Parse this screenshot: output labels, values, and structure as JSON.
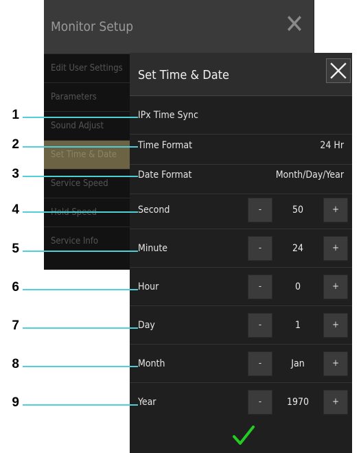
{
  "background_dialog": {
    "title": "Monitor Setup",
    "items": [
      "Edit User Settings",
      "Parameters",
      "Sound Adjust",
      "Set Time & Date",
      "Service Speed",
      "Hold Speed",
      "Service Info"
    ],
    "selected_index": 3
  },
  "dialog": {
    "title": "Set Time & Date",
    "rows": [
      {
        "label": "IPx Time Sync"
      },
      {
        "label": "Time Format",
        "value": "24 Hr"
      },
      {
        "label": "Date Format",
        "value": "Month/Day/Year"
      },
      {
        "label": "Second",
        "value": "50",
        "minus": "-",
        "plus": "+"
      },
      {
        "label": "Minute",
        "value": "24",
        "minus": "-",
        "plus": "+"
      },
      {
        "label": "Hour",
        "value": "0",
        "minus": "-",
        "plus": "+"
      },
      {
        "label": "Day",
        "value": "1",
        "minus": "-",
        "plus": "+"
      },
      {
        "label": "Month",
        "value": "Jan",
        "minus": "-",
        "plus": "+"
      },
      {
        "label": "Year",
        "value": "1970",
        "minus": "-",
        "plus": "+"
      }
    ]
  },
  "callouts": [
    "1",
    "2",
    "3",
    "4",
    "5",
    "6",
    "7",
    "8",
    "9"
  ],
  "colors": {
    "callout_line": "#4fd0d8",
    "confirm_check": "#22cc22",
    "dialog_bg": "#1f1f1f"
  },
  "icons": {
    "close": "close-icon",
    "confirm": "checkmark-icon"
  }
}
